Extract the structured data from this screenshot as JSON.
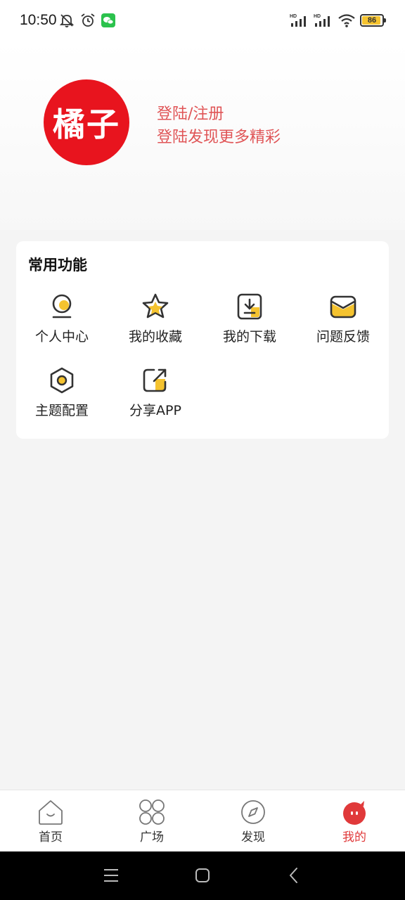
{
  "status_bar": {
    "time": "10:50",
    "battery": "86",
    "signal_badge": "HD"
  },
  "profile": {
    "logo_text": "橘子",
    "login_title": "登陆/注册",
    "login_subtitle": "登陆发现更多精彩"
  },
  "features": {
    "title": "常用功能",
    "items": [
      {
        "label": "个人中心",
        "icon": "person-icon"
      },
      {
        "label": "我的收藏",
        "icon": "star-icon"
      },
      {
        "label": "我的下载",
        "icon": "download-icon"
      },
      {
        "label": "问题反馈",
        "icon": "mail-icon"
      },
      {
        "label": "主题配置",
        "icon": "theme-icon"
      },
      {
        "label": "分享APP",
        "icon": "share-icon"
      }
    ]
  },
  "bottom_nav": {
    "items": [
      {
        "label": "首页",
        "icon": "home-icon"
      },
      {
        "label": "广场",
        "icon": "grid-icon"
      },
      {
        "label": "发现",
        "icon": "compass-icon"
      },
      {
        "label": "我的",
        "icon": "mine-icon",
        "active": true
      }
    ]
  },
  "colors": {
    "accent": "#e0393a",
    "brand_red": "#e8141e",
    "login_text": "#e05557",
    "icon_yellow": "#f5c32f"
  }
}
